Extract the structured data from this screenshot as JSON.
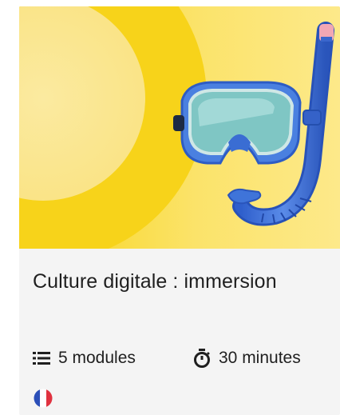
{
  "course": {
    "title": "Culture digitale : immersion",
    "modules": "5 modules",
    "duration": "30 minutes",
    "language_icon": "french-flag-icon",
    "illustration": "snorkel-mask-illustration"
  },
  "colors": {
    "hero_background": "#f7d51b",
    "mask_blue": "#3d6fd6",
    "snorkel_tip": "#f2a7b4",
    "text": "#1f1f1f"
  }
}
